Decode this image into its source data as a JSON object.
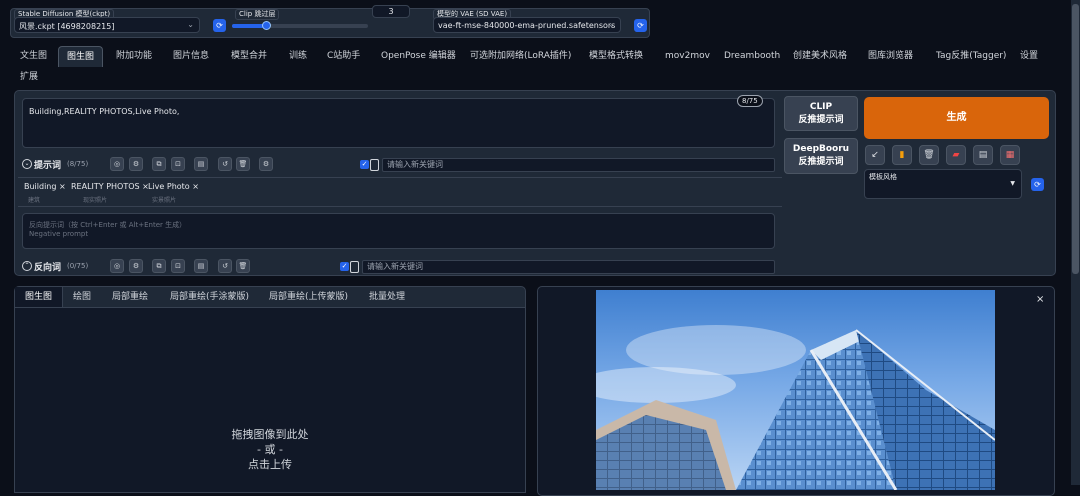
{
  "top": {
    "model_label": "Stable Diffusion 模型(ckpt)",
    "model_value": "风景.ckpt [4698208215]",
    "clip_label": "Clip 跳过层",
    "clip_value": "3",
    "clip_fraction": 0.25,
    "vae_label": "模型的 VAE (SD VAE)",
    "vae_value": "vae-ft-mse-840000-ema-pruned.safetensors"
  },
  "tabs": [
    "文生图",
    "图生图",
    "附加功能",
    "图片信息",
    "模型合并",
    "训练",
    "C站助手",
    "OpenPose 编辑器",
    "可选附加网络(LoRA插件)",
    "模型格式转换",
    "mov2mov",
    "Dreambooth",
    "创建美术风格",
    "图库浏览器",
    "Tag反推(Tagger)",
    "设置",
    "扩展"
  ],
  "prompt": {
    "text": "Building,REALITY PHOTOS,Live Photo,",
    "counter": "8/75",
    "label": "提示词",
    "label_count": "(8/75)",
    "keyword_placeholder": "请输入新关键词",
    "chips": [
      {
        "label": "Building",
        "sub": "建筑"
      },
      {
        "label": "REALITY PHOTOS",
        "sub": "现实照片"
      },
      {
        "label": "Live Photo",
        "sub": "实景照片"
      }
    ]
  },
  "negative": {
    "placeholder_cn": "反向提示词（按 Ctrl+Enter 或 Alt+Enter 生成）",
    "placeholder_en": "Negative prompt",
    "label": "反向词",
    "label_count": "(0/75)",
    "keyword_placeholder": "请输入新关键词"
  },
  "buttons": {
    "clip_1": "CLIP",
    "clip_2": "反推提示词",
    "deep_1": "DeepBooru",
    "deep_2": "反推提示词",
    "generate": "生成",
    "style_label": "模板风格"
  },
  "img2img": {
    "subtabs": [
      "图生图",
      "绘图",
      "局部重绘",
      "局部重绘(手涂蒙版)",
      "局部重绘(上传蒙版)",
      "批量处理"
    ],
    "drop_1": "拖拽图像到此处",
    "drop_2": "- 或 -",
    "drop_3": "点击上传"
  },
  "output": {
    "close": "×"
  },
  "colors": {
    "accent": "#2563eb",
    "generate": "#d9650b",
    "bg": "#0b0f19",
    "panel": "#1f2937"
  }
}
